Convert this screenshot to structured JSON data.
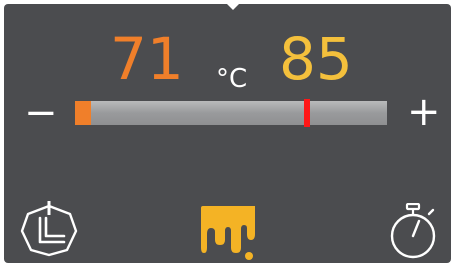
{
  "display": {
    "current_temp": "71",
    "unit": "°C",
    "target_temp": "85",
    "decrease_label": "−",
    "increase_label": "+"
  },
  "slider": {
    "current_fraction": 0.05,
    "target_fraction": 0.745
  },
  "icons": {
    "left": "heater-icon",
    "center": "melting-drip-icon",
    "right": "stopwatch-icon"
  },
  "colors": {
    "background": "#4b4c4f",
    "current_temp": "#f07f2a",
    "target_temp": "#f4c03c",
    "target_marker": "#ff1717",
    "active_icon": "#f4b325",
    "icon": "#ffffff"
  }
}
